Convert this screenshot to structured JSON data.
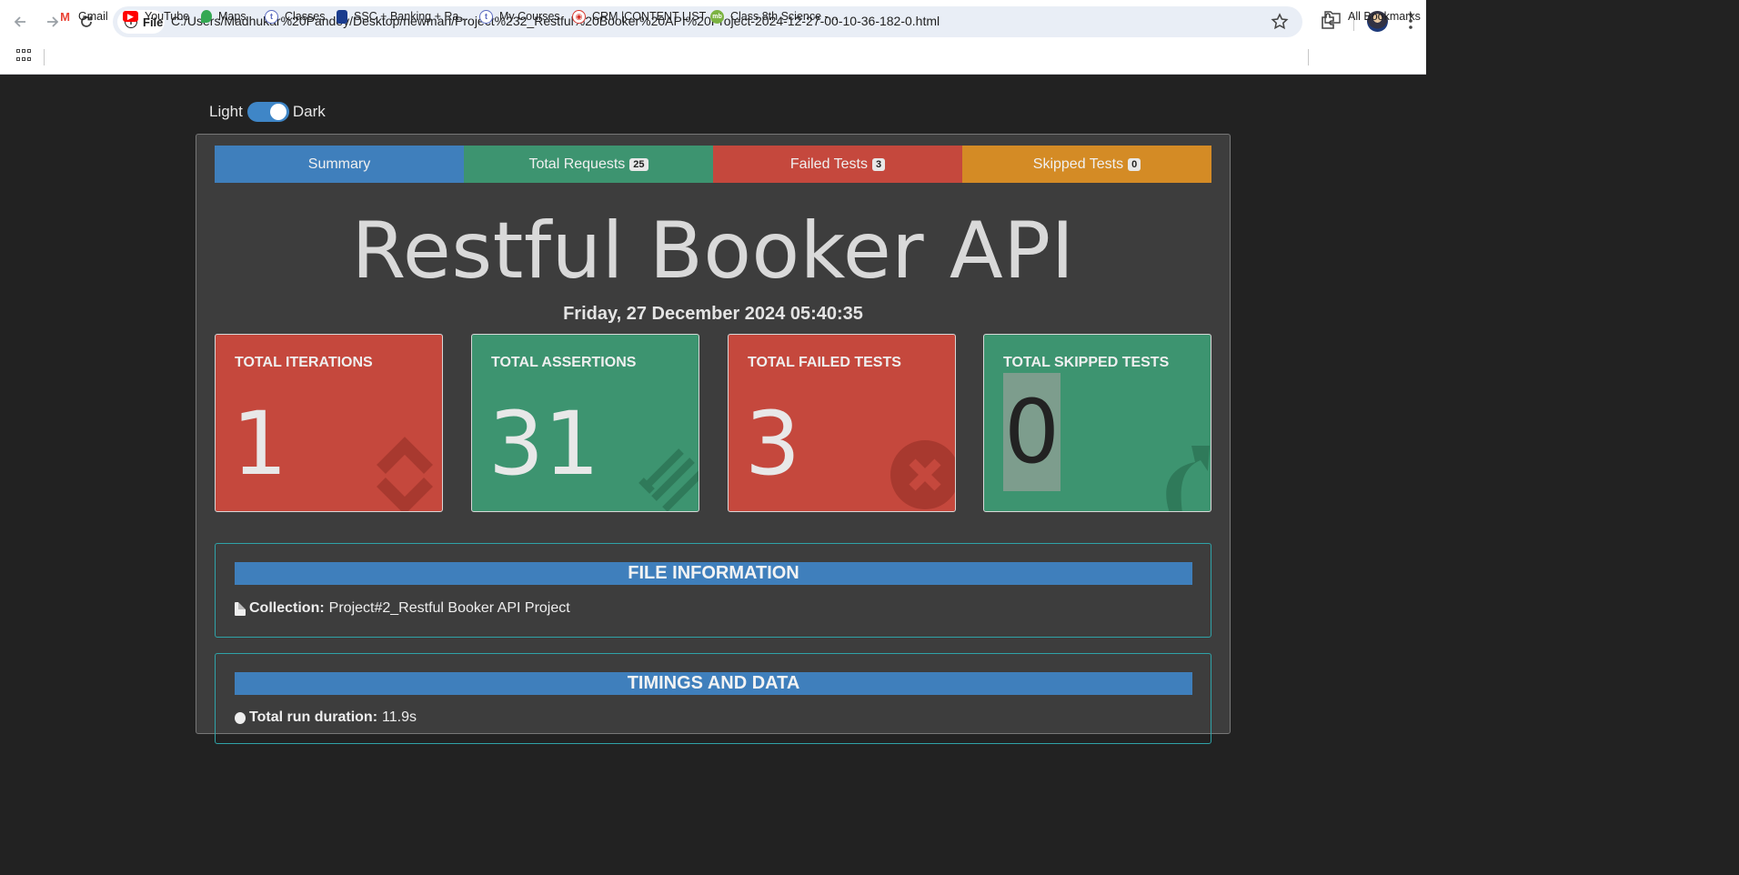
{
  "browser": {
    "chip_label": "File",
    "url": "C:/Users/Madhukar%20Pandey/Desktop/newman/Project%232_Restful%20Booker%20API%20Project-2024-12-27-00-10-36-182-0.html",
    "bookmarks": [
      {
        "label": "Gmail",
        "icon": "gmail-icon",
        "color": "#EA4335"
      },
      {
        "label": "YouTube",
        "icon": "youtube-icon",
        "color": "#FF0000"
      },
      {
        "label": "Maps",
        "icon": "maps-icon",
        "color": "#34A853"
      },
      {
        "label": "Classes",
        "icon": "classes-icon",
        "color": "#5B6BC0"
      },
      {
        "label": "SSC + Banking + Ra...",
        "icon": "ssc-icon",
        "color": "#1A3C8E"
      },
      {
        "label": "My Courses",
        "icon": "courses-icon",
        "color": "#5B6BC0"
      },
      {
        "label": "CRM |CONTENT LIST",
        "icon": "crm-icon",
        "color": "#D9342B"
      },
      {
        "label": "Class 8th Science -...",
        "icon": "mb-icon",
        "color": "#7CB342"
      }
    ],
    "all_bookmarks": "All Bookmarks"
  },
  "toggle": {
    "light": "Light",
    "dark": "Dark"
  },
  "tabs": [
    {
      "label": "Summary",
      "badge": ""
    },
    {
      "label": "Total Requests",
      "badge": "25"
    },
    {
      "label": "Failed Tests",
      "badge": "3"
    },
    {
      "label": "Skipped Tests",
      "badge": "0"
    }
  ],
  "report": {
    "title": "Restful Booker API",
    "date": "Friday, 27 December 2024 05:40:35"
  },
  "stats": [
    {
      "label": "TOTAL ITERATIONS",
      "value": "1",
      "icon": "refresh-icon"
    },
    {
      "label": "TOTAL ASSERTIONS",
      "value": "31",
      "icon": "tasks-icon"
    },
    {
      "label": "TOTAL FAILED TESTS",
      "value": "3",
      "icon": "times-circle-icon"
    },
    {
      "label": "TOTAL SKIPPED TESTS",
      "value": "0",
      "icon": "share-arrow-icon"
    }
  ],
  "file_info": {
    "heading": "FILE INFORMATION",
    "collection_label": "Collection:",
    "collection_value": "Project#2_Restful Booker API Project"
  },
  "timings": {
    "heading": "TIMINGS AND DATA",
    "duration_label": "Total run duration:",
    "duration_value": "11.9s"
  },
  "colors": {
    "blue": "#3f7fbc",
    "green": "#3d9470",
    "red": "#c5483d",
    "orange": "#d48b25",
    "background": "#222222",
    "card": "#3d3d3d"
  }
}
